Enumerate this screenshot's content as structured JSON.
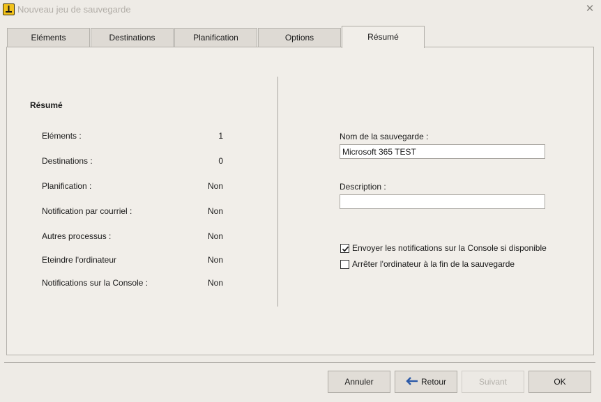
{
  "window": {
    "title": "Nouveau jeu de sauvegarde",
    "close_glyph": "✕",
    "app_icon": "app-logo-icon"
  },
  "tabs": [
    {
      "label": "Eléments",
      "active": false
    },
    {
      "label": "Destinations",
      "active": false
    },
    {
      "label": "Planification",
      "active": false
    },
    {
      "label": "Options",
      "active": false
    },
    {
      "label": "Résumé",
      "active": true
    }
  ],
  "summary": {
    "title": "Résumé",
    "rows": [
      {
        "label": "Eléments :",
        "value": "1"
      },
      {
        "label": "Destinations :",
        "value": "0"
      },
      {
        "label": "Planification :",
        "value": "Non"
      },
      {
        "label": "Notification par courriel :",
        "value": "Non"
      },
      {
        "label": "Autres processus :",
        "value": "Non"
      },
      {
        "label": "Eteindre l'ordinateur",
        "value": "Non"
      },
      {
        "label": "Notifications sur la Console :",
        "value": "Non"
      }
    ]
  },
  "form": {
    "name_label": "Nom de la sauvegarde :",
    "name_value": "Microsoft 365 TEST",
    "description_label": "Description :",
    "description_value": "",
    "checkboxes": [
      {
        "label": "Envoyer les notifications sur la Console si disponible",
        "checked": true
      },
      {
        "label": "Arrêter l'ordinateur à la fin de la sauvegarde",
        "checked": false
      }
    ]
  },
  "footer": {
    "cancel_label": "Annuler",
    "back_label": "Retour",
    "next_label": "Suivant",
    "ok_label": "OK"
  },
  "colors": {
    "window_bg": "#eeebe6",
    "panel_bg": "#f1eee9",
    "app_icon_bg": "#f2c21b",
    "arrow_blue": "#2c5aa8"
  }
}
